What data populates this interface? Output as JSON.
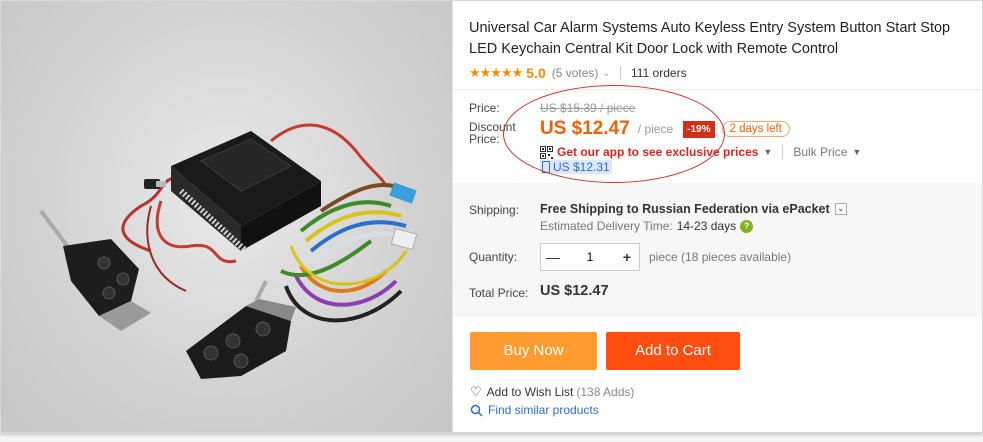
{
  "product": {
    "title": "Universal Car Alarm Systems Auto Keyless Entry System Button Start Stop LED Keychain Central Kit Door Lock with Remote Control",
    "rating": {
      "stars": "★★★★★",
      "score": "5.0",
      "votes": "(5 votes)",
      "orders": "111 orders"
    }
  },
  "price": {
    "price_label": "Price:",
    "original": "US $15.39 / piece",
    "discount_label": "Discount Price:",
    "discount": "US $12.47",
    "per_unit": "/ piece",
    "discount_pct": "-19%",
    "time_left": "2 days left",
    "app_promo": "Get our app to see exclusive prices",
    "bulk": "Bulk Price",
    "app_price": "US $12.31"
  },
  "shipping": {
    "label": "Shipping:",
    "method": "Free Shipping to Russian Federation via ePacket",
    "delivery_label": "Estimated Delivery Time:",
    "delivery_time": "14-23 days"
  },
  "quantity": {
    "label": "Quantity:",
    "value": "1",
    "minus": "—",
    "plus": "+",
    "available": "piece (18 pieces available)"
  },
  "total": {
    "label": "Total Price:",
    "value": "US $12.47"
  },
  "actions": {
    "buy_now": "Buy Now",
    "add_to_cart": "Add to Cart",
    "wishlist": "Add to Wish List",
    "wishlist_count": "(138 Adds)",
    "find_similar": "Find similar products"
  },
  "colors": {
    "accent_orange": "#f06000",
    "buy_now": "#ff9b2f",
    "add_to_cart": "#ff4e0f",
    "discount_badge": "#d32f16",
    "link_blue": "#2a6fc9"
  }
}
